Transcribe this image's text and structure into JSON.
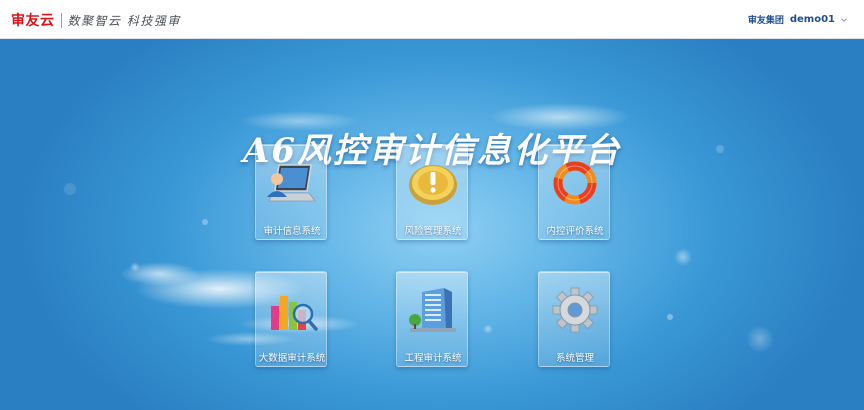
{
  "header": {
    "brand_name": "审友云",
    "brand_slogan": "数聚智云 科技强审",
    "user_org": "审友集团",
    "user_name": "demo01"
  },
  "main": {
    "title": "A6风控审计信息化平台",
    "tiles": [
      {
        "label": "审计信息系统",
        "icon": "computer-user-icon"
      },
      {
        "label": "风险管理系统",
        "icon": "warning-icon"
      },
      {
        "label": "内控评价系统",
        "icon": "ring-icon"
      },
      {
        "label": "大数据审计系统",
        "icon": "bar-chart-magnifier-icon"
      },
      {
        "label": "工程审计系统",
        "icon": "building-icon"
      },
      {
        "label": "系统管理",
        "icon": "gear-icon"
      }
    ]
  },
  "colors": {
    "brand_red": "#e0121b",
    "user_blue": "#1d4f91",
    "background_blue": "#2f8fd3"
  }
}
